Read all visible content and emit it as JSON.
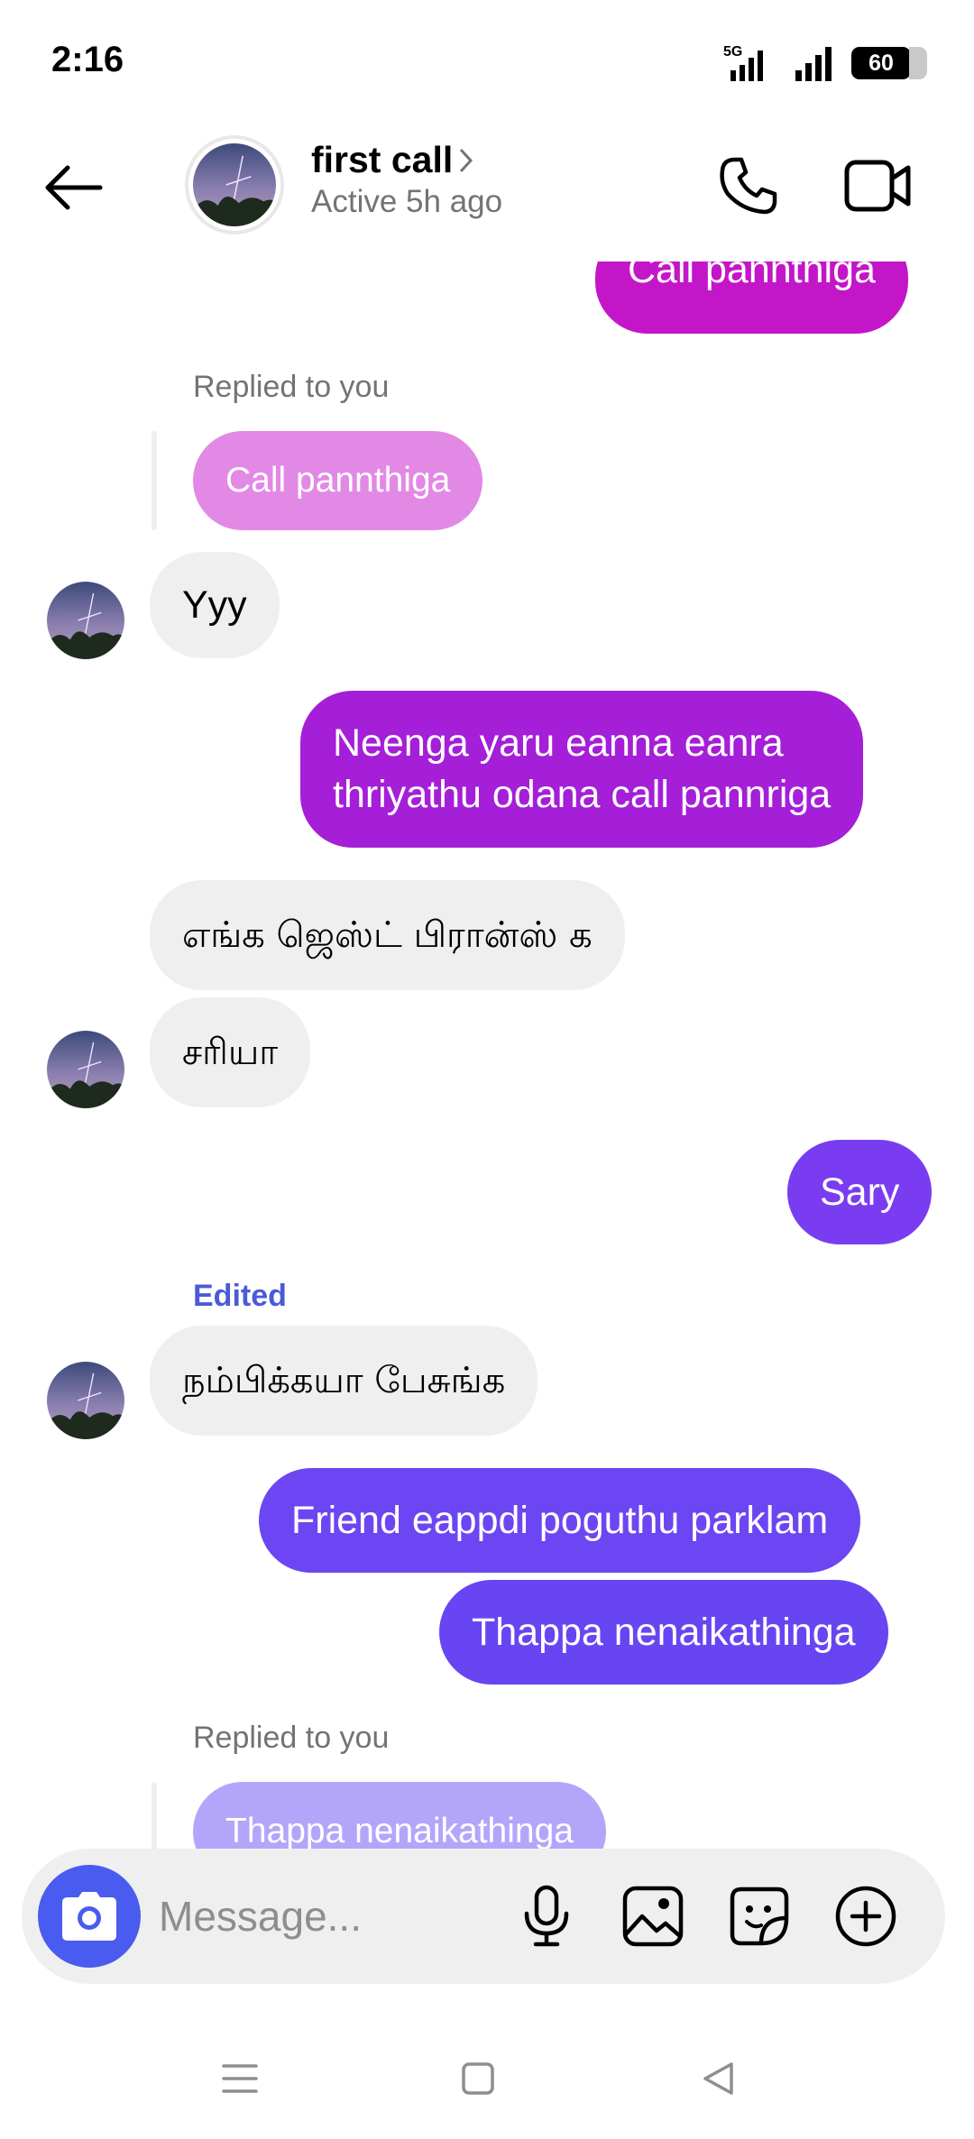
{
  "status_bar": {
    "time": "2:16",
    "network": "5G",
    "battery": "60"
  },
  "header": {
    "contact_name": "first call",
    "status": "Active 5h ago"
  },
  "messages": [
    {
      "id": "m1",
      "direction": "outgoing",
      "text": "Call pannthiga",
      "color": "#c416c9"
    },
    {
      "id": "m2",
      "direction": "incoming",
      "reply_label": "Replied to you",
      "quoted_text": "Call pannthiga",
      "quoted_color": "#e289e6",
      "text": "Yyy"
    },
    {
      "id": "m3",
      "direction": "outgoing",
      "lines": [
        "Neenga yaru eanna eanra",
        "thriyathu odana call pannriga"
      ],
      "color": "#a51ed8"
    },
    {
      "id": "m4",
      "direction": "incoming",
      "text": "எங்க ஜெஸ்ட் பிரான்ஸ் க"
    },
    {
      "id": "m5",
      "direction": "incoming",
      "text": "சரியா"
    },
    {
      "id": "m6",
      "direction": "outgoing",
      "text": "Sary",
      "color": "#7a3cf0"
    },
    {
      "id": "m7",
      "direction": "incoming",
      "edited_label": "Edited",
      "text": "நம்பிக்கயா பேசுங்க"
    },
    {
      "id": "m8",
      "direction": "outgoing",
      "text": "Friend eappdi poguthu parklam",
      "color": "#6b46f2"
    },
    {
      "id": "m9",
      "direction": "outgoing",
      "text": "Thappa nenaikathinga",
      "color": "#6745f2"
    },
    {
      "id": "m10",
      "direction": "incoming",
      "reply_label": "Replied to you",
      "quoted_text": "Thappa nenaikathinga",
      "quoted_color": "#b3a6fa"
    }
  ],
  "composer": {
    "placeholder": "Message..."
  },
  "icons": {
    "back": "arrow-left-icon",
    "call": "phone-icon",
    "video": "video-camera-icon",
    "camera": "camera-icon",
    "mic": "microphone-icon",
    "gallery": "image-icon",
    "sticker": "sticker-icon",
    "more": "plus-circle-icon"
  }
}
